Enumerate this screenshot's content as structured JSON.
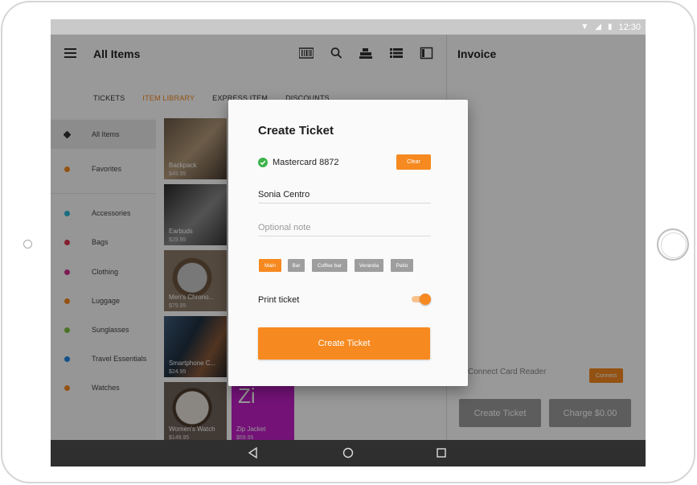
{
  "status_bar": {
    "time": "12:30",
    "icons": [
      "wifi-icon",
      "signal-icon",
      "battery-icon"
    ]
  },
  "header": {
    "title": "All Items",
    "icons": [
      "barcode-icon",
      "search-icon",
      "register-icon",
      "list-view-icon",
      "panel-icon"
    ]
  },
  "tabs": [
    {
      "label": "TICKETS",
      "active": false
    },
    {
      "label": "ITEM LIBRARY",
      "active": true
    },
    {
      "label": "EXPRESS ITEM",
      "active": false
    },
    {
      "label": "DISCOUNTS",
      "active": false
    }
  ],
  "categories": [
    {
      "label": "All Items",
      "color": "#333333",
      "selected": true,
      "icon": "box-icon"
    },
    {
      "label": "Favorites",
      "color": "#f6891f",
      "selected": false,
      "icon": "heart-icon"
    },
    {
      "label": "Accessories",
      "color": "#29b6d8",
      "selected": false
    },
    {
      "label": "Bags",
      "color": "#e0344e",
      "selected": false
    },
    {
      "label": "Clothing",
      "color": "#d0308c",
      "selected": false
    },
    {
      "label": "Luggage",
      "color": "#f6891f",
      "selected": false
    },
    {
      "label": "Sunglasses",
      "color": "#7dc242",
      "selected": false
    },
    {
      "label": "Travel Essentials",
      "color": "#1e88e5",
      "selected": false
    },
    {
      "label": "Watches",
      "color": "#f6891f",
      "selected": false
    }
  ],
  "items": [
    {
      "name": "Backpack",
      "price": "$49.95"
    },
    {
      "name": "Earbuds",
      "price": "$29.95"
    },
    {
      "name": "Men's Chrono...",
      "price": "$79.95"
    },
    {
      "name": "Smartphone C...",
      "price": "$24.95"
    },
    {
      "name": "Women's Watch",
      "price": "$149.95"
    },
    {
      "name": "Zip Jacket",
      "price": "$59.95",
      "letter": "Zi"
    }
  ],
  "invoice": {
    "title": "Invoice",
    "reader_text": "Connect Card Reader",
    "connect_label": "Connect",
    "create_ticket_label": "Create Ticket",
    "charge_label": "Charge $0.00"
  },
  "dialog": {
    "title": "Create Ticket",
    "card_label": "Mastercard 8872",
    "clear_label": "Clear",
    "customer_name": "Sonia Centro",
    "note_placeholder": "Optional note",
    "locations": [
      {
        "label": "Main",
        "active": true
      },
      {
        "label": "Bar",
        "active": false
      },
      {
        "label": "Coffee bar",
        "active": false
      },
      {
        "label": "Veranda",
        "active": false
      },
      {
        "label": "Patio",
        "active": false
      }
    ],
    "print_label": "Print ticket",
    "print_enabled": true,
    "submit_label": "Create Ticket"
  },
  "colors": {
    "accent": "#f6891f",
    "navbar": "#2f2f2f"
  }
}
